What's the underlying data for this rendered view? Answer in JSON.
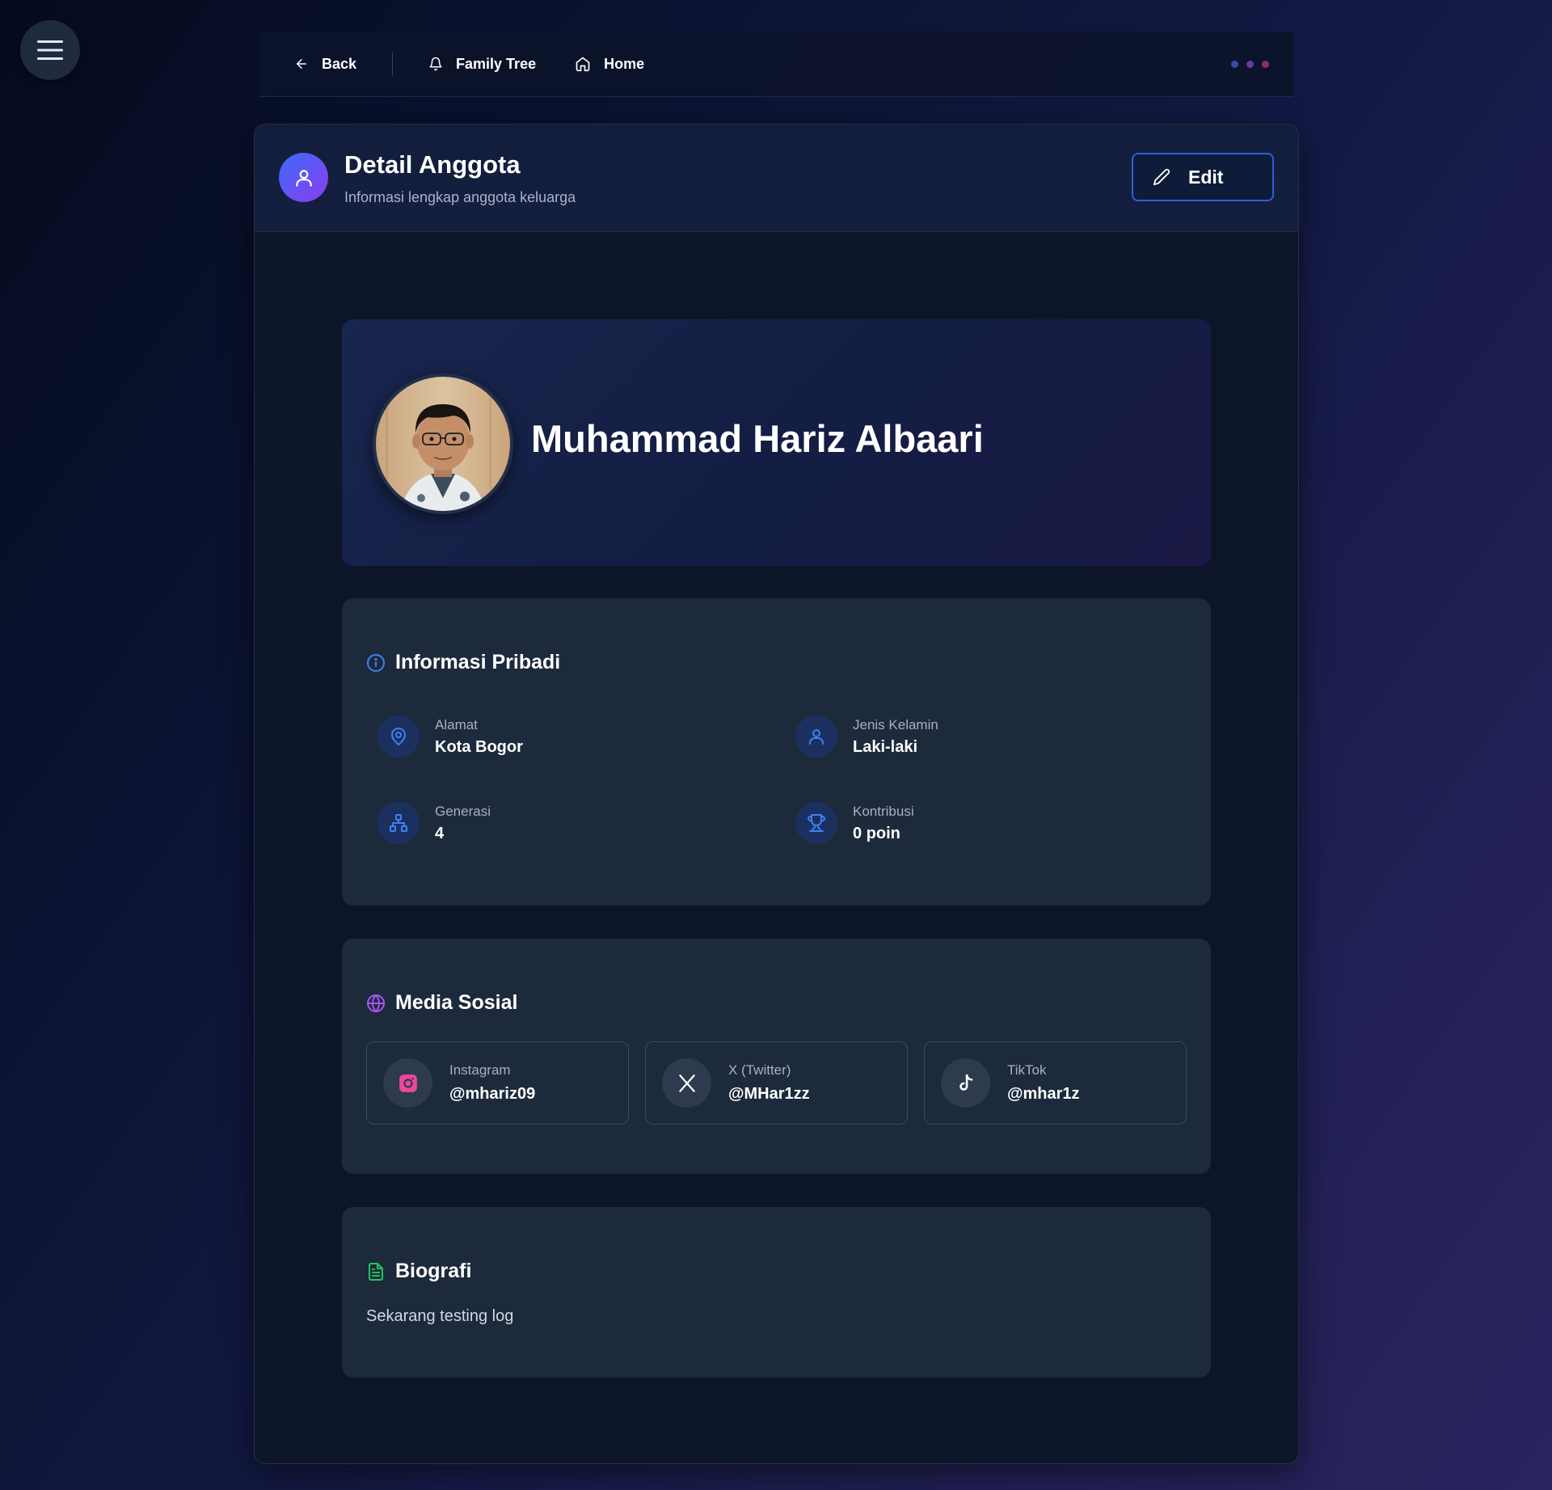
{
  "nav": {
    "back_label": "Back",
    "family_tree_label": "Family Tree",
    "home_label": "Home",
    "dot_colors": [
      "#3a4aa8",
      "#6a3a9a",
      "#8a3060"
    ]
  },
  "header": {
    "title": "Detail Anggota",
    "subtitle": "Informasi lengkap anggota keluarga",
    "edit_label": "Edit"
  },
  "profile": {
    "name": "Muhammad Hariz Albaari"
  },
  "personal_info": {
    "title": "Informasi Pribadi",
    "items": [
      {
        "label": "Alamat",
        "value": "Kota Bogor",
        "icon": "map-pin-icon"
      },
      {
        "label": "Jenis Kelamin",
        "value": "Laki-laki",
        "icon": "user-icon"
      },
      {
        "label": "Generasi",
        "value": "4",
        "icon": "hierarchy-icon"
      },
      {
        "label": "Kontribusi",
        "value": "0 poin",
        "icon": "trophy-icon"
      }
    ]
  },
  "social": {
    "title": "Media Sosial",
    "items": [
      {
        "label": "Instagram",
        "value": "@mhariz09",
        "icon": "instagram-icon"
      },
      {
        "label": "X (Twitter)",
        "value": "@MHar1zz",
        "icon": "x-twitter-icon"
      },
      {
        "label": "TikTok",
        "value": "@mhar1z",
        "icon": "tiktok-icon"
      }
    ]
  },
  "bio": {
    "title": "Biografi",
    "text": "Sekarang testing log"
  },
  "colors": {
    "accent_blue": "#3b82f6",
    "accent_purple": "#a855f7",
    "accent_green": "#22c55e",
    "instagram_pink": "#ec4899"
  }
}
